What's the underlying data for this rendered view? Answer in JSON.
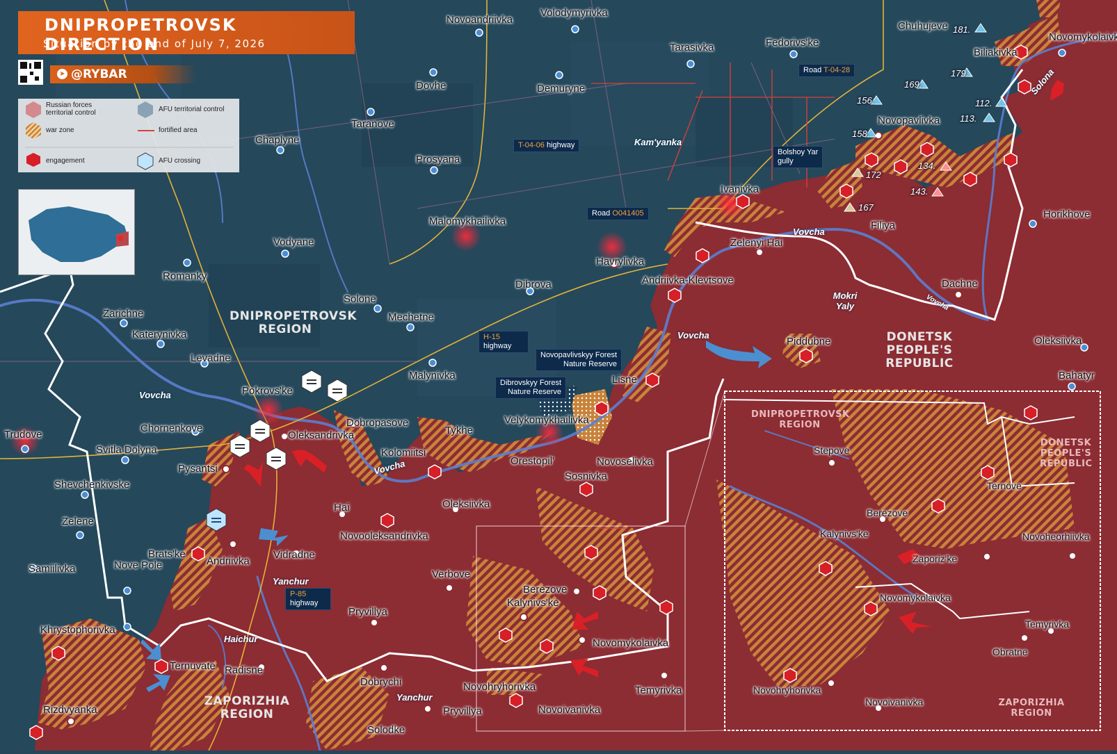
{
  "header": {
    "title": "DNIPROPETROVSK DIRECTION",
    "subtitle": "Situation by the end of July 7, 2026",
    "handle": "@RYBAR"
  },
  "legend": {
    "russian_control": "Russian forces territorial control",
    "afu_control": "AFU territorial control",
    "war_zone": "war zone",
    "fortified_area": "fortified area",
    "engagement": "engagement",
    "afu_crossing": "AFU crossing"
  },
  "colors": {
    "russian": "#8c2c33",
    "afu": "#24475a",
    "warzone_a": "#c8833a",
    "warzone_b": "#8c2c33",
    "accent": "#e0641e",
    "engagement": "#d61f26"
  },
  "regions": {
    "dnipro": "DNIPROPETROVSK REGION",
    "donetsk": "DONETSK PEOPLE'S REPUBLIC",
    "zaporizhia": "ZAPORIZHIA REGION"
  },
  "roads": {
    "t0428": {
      "prefix": "Road ",
      "code": "T-04-28"
    },
    "t0406": {
      "code": "T-04-06",
      "suffix": " highway"
    },
    "o041405": {
      "prefix": "Road ",
      "code": "O041405"
    },
    "h15": {
      "code": "H-15",
      "suffix": "highway"
    },
    "p85": {
      "code": "P-85",
      "suffix": "highway"
    },
    "bolshoy": {
      "line1": "Bolshoy Yar",
      "line2": "gully"
    }
  },
  "reserves": {
    "novopavlivskyy": {
      "line1": "Novopavlivskyy Forest",
      "line2": "Nature Reserve"
    },
    "dibrovskyy": {
      "line1": "Dibrovskyy Forest",
      "line2": "Nature Reserve"
    }
  },
  "rivers": [
    "Vovcha",
    "Vovcha",
    "Vovcha",
    "Vovcha",
    "Yanchur",
    "Yanchur",
    "Haichur",
    "Kam'yanka",
    "Mokri Yaly",
    "Solona",
    "Vovcha"
  ],
  "places": [
    "Novoandriivka",
    "Volodymyrivka",
    "Tarasivka",
    "Fedorivs'ke",
    "Chuhujeve",
    "Novomykolaivka",
    "Biliakivka",
    "Dovhe",
    "Demuryne",
    "Taranove",
    "Chaplyne",
    "Prosyana",
    "Novopavlivka",
    "Malomykhailivka",
    "Ivanivka",
    "Filiya",
    "Havrylivka",
    "Zelenyi Hai",
    "Vodyane",
    "Romanky",
    "Dibrova",
    "Andriivka-Klevtsove",
    "Dachne",
    "Horikhove",
    "Solone",
    "Zarichne",
    "Mechetne",
    "Katerynivka",
    "Piddubne",
    "Oleksiivka",
    "Levadne",
    "Bahatyr",
    "Pokrovs'ke",
    "Malynivka",
    "Lisne",
    "Chornenkove",
    "Dobropasove",
    "Velykomykhailivka",
    "Trudove",
    "Oleksandrivka",
    "Tykhe",
    "Svitla Dolyna",
    "Kolomiitsi",
    "Orestopil'",
    "Novoselivka",
    "Pysantsi",
    "Shevchenkivske",
    "Sosnivka",
    "Oleksiivka",
    "Hai",
    "Zelene",
    "Novooleksandrivka",
    "Brats'ke",
    "Andriivka",
    "Vidradne",
    "Samiilivka",
    "Nove Pole",
    "Verbove",
    "Berezove",
    "Kalynivs'ke",
    "Pryvillya",
    "Khrystophorivka",
    "Novomykolaivka",
    "Ternuvate",
    "Radisne",
    "Dobrychi",
    "Novohryhorivka",
    "Temyrivka",
    "Rizdvyanka",
    "Novoivanivka",
    "Pryvillya",
    "Solodke"
  ],
  "heights": [
    "181.",
    "179.",
    "169.",
    "156.",
    "112.",
    "113.",
    "158.",
    "172",
    "134.",
    "143.",
    "167"
  ],
  "inset": {
    "dnipro": "DNIPROPETROVSK REGION",
    "donetsk": "DONETSK PEOPLE'S REPUBLIC",
    "zaporizhia": "ZAPORIZHIA REGION",
    "places": [
      "Stepove",
      "Ternove",
      "Berezove",
      "Kalynivs'ke",
      "Novoheorhiivka",
      "Zaporiz'ke",
      "Novomykolaivka",
      "Temyrivka",
      "Obratne",
      "Novohryhorivka",
      "Novoivanivka"
    ]
  }
}
